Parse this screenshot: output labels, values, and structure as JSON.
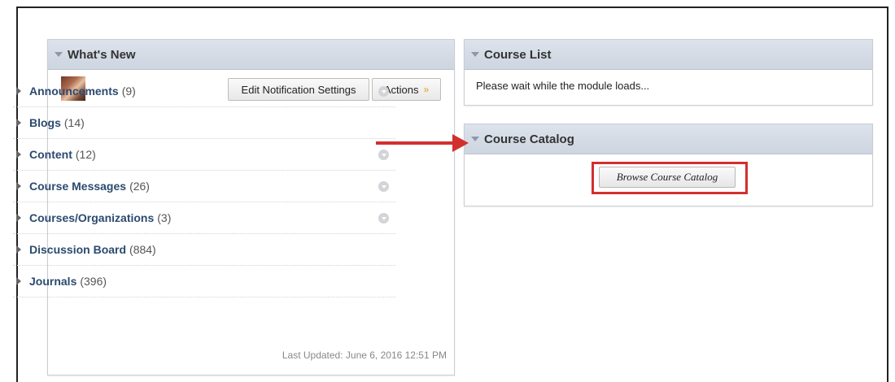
{
  "whats_new": {
    "title": "What's New",
    "edit_notification_label": "Edit Notification Settings",
    "actions_label": "Actions",
    "items": [
      {
        "label": "Announcements",
        "count": "(9)"
      },
      {
        "label": "Blogs",
        "count": "(14)"
      },
      {
        "label": "Content",
        "count": "(12)"
      },
      {
        "label": "Course Messages",
        "count": "(26)"
      },
      {
        "label": "Courses/Organizations",
        "count": "(3)"
      },
      {
        "label": "Discussion Board",
        "count": "(884)"
      },
      {
        "label": "Journals",
        "count": "(396)"
      }
    ],
    "last_updated": "Last Updated: June 6, 2016 12:51 PM"
  },
  "course_list": {
    "title": "Course List",
    "message": "Please wait while the module loads..."
  },
  "course_catalog": {
    "title": "Course Catalog",
    "browse_label": "Browse Course Catalog"
  },
  "colors": {
    "highlight": "#d32f2f",
    "link": "#2b4a6f",
    "header_bg": "#d5dce6"
  }
}
